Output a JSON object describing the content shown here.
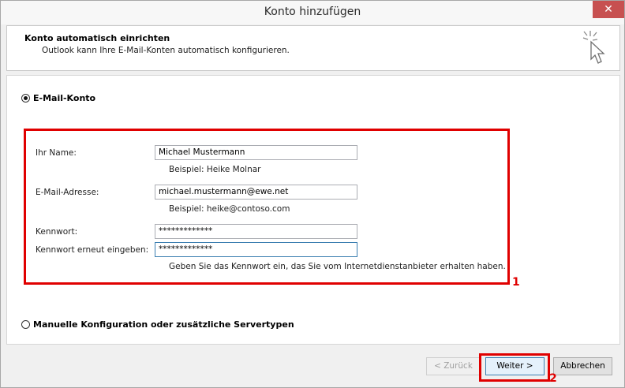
{
  "window": {
    "title": "Konto hinzufügen",
    "close_glyph": "✕"
  },
  "header": {
    "title": "Konto automatisch einrichten",
    "subtitle": "Outlook kann Ihre E-Mail-Konten automatisch konfigurieren.",
    "icon": "wizard-cursor-icon"
  },
  "options": {
    "email_account": {
      "label": "E-Mail-Konto",
      "selected": true
    },
    "manual": {
      "label": "Manuelle Konfiguration oder zusätzliche Servertypen",
      "selected": false
    }
  },
  "form": {
    "name": {
      "label": "Ihr Name:",
      "value": "Michael Mustermann",
      "hint": "Beispiel: Heike Molnar"
    },
    "email": {
      "label": "E-Mail-Adresse:",
      "value": "michael.mustermann@ewe.net",
      "hint": "Beispiel: heike@contoso.com"
    },
    "password": {
      "label": "Kennwort:",
      "value": "*************"
    },
    "password_repeat": {
      "label": "Kennwort erneut eingeben:",
      "value": "*************"
    },
    "password_hint": "Geben Sie das Kennwort ein, das Sie vom Internetdienstanbieter erhalten haben."
  },
  "annotations": {
    "marker_1": "1",
    "marker_2": "2",
    "highlight_color": "#e00000"
  },
  "buttons": {
    "back": "< Zurück",
    "next": "Weiter >",
    "cancel": "Abbrechen"
  }
}
